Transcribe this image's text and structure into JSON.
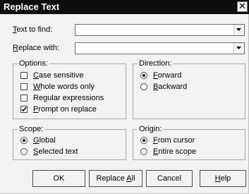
{
  "window": {
    "title": "Replace Text",
    "close_symbol": "✕"
  },
  "fields": {
    "find": {
      "label_u": "T",
      "label_rest": "ext to find:",
      "value": ""
    },
    "replace": {
      "label_u": "R",
      "label_rest": "eplace with:",
      "value": ""
    }
  },
  "options": {
    "title": "Options:",
    "items": [
      {
        "u": "C",
        "rest": "ase sensitive",
        "checked": false
      },
      {
        "u": "W",
        "rest": "hole words only",
        "checked": false
      },
      {
        "u": "",
        "rest": "Regular expressions",
        "checked": false
      },
      {
        "u": "P",
        "rest": "rompt on replace",
        "checked": true
      }
    ]
  },
  "direction": {
    "title": "Direction:",
    "items": [
      {
        "pre": "",
        "u": "F",
        "rest": "orward",
        "selected": true
      },
      {
        "pre": "",
        "u": "B",
        "rest": "ackward",
        "selected": false
      }
    ]
  },
  "scope": {
    "title": "Scope:",
    "items": [
      {
        "pre": "",
        "u": "G",
        "rest": "lobal",
        "selected": true
      },
      {
        "pre": "",
        "u": "S",
        "rest": "elected text",
        "selected": false
      }
    ]
  },
  "origin": {
    "title": "Origin:",
    "items": [
      {
        "pre": "",
        "u": "F",
        "rest": "rom cursor",
        "selected": true
      },
      {
        "pre": "",
        "u": "E",
        "rest": "ntire scope",
        "selected": false
      }
    ]
  },
  "buttons": {
    "ok": {
      "pre": "OK",
      "u": "",
      "rest": ""
    },
    "replace_all": {
      "pre": "Replace ",
      "u": "A",
      "rest": "ll"
    },
    "cancel": {
      "pre": "Cancel",
      "u": "",
      "rest": ""
    },
    "help": {
      "pre": "",
      "u": "H",
      "rest": "elp"
    }
  }
}
